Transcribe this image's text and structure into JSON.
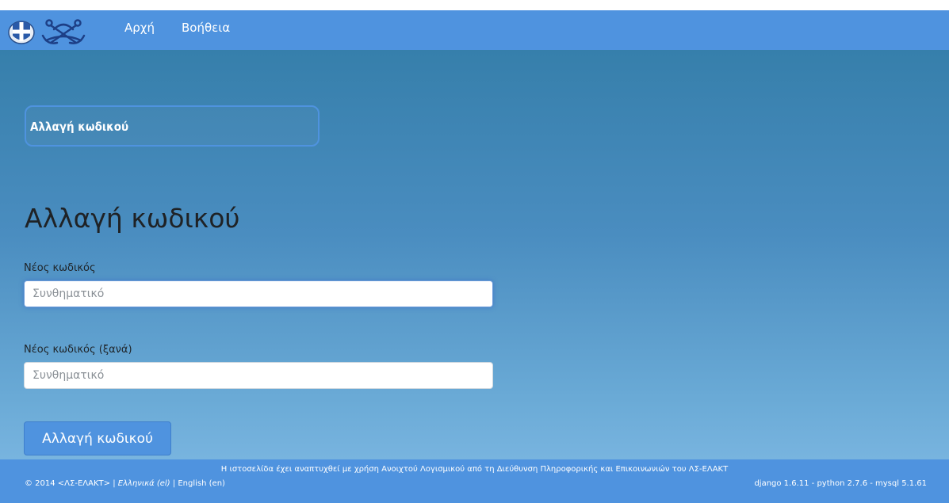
{
  "navbar": {
    "links": [
      "Αρχή",
      "Βοήθεια"
    ],
    "icons": [
      "greek-coat-of-arms-icon",
      "crossed-anchors-icon"
    ]
  },
  "breadcrumb": {
    "label": "Αλλαγή κωδικού"
  },
  "page": {
    "title": "Αλλαγή κωδικού"
  },
  "form": {
    "new_password": {
      "label": "Νέος κωδικός",
      "placeholder": "Συνθηματικό",
      "value": ""
    },
    "repeat_password": {
      "label": "Νέος κωδικός (ξανά)",
      "placeholder": "Συνθηματικό",
      "value": ""
    },
    "submit_label": "Αλλαγή κωδικού"
  },
  "footer": {
    "developed_by": "Η ιστοσελίδα έχει αναπτυχθεί με χρήση Ανοιχτού Λογισμικού από τη Διεύθυνση Πληροφορικής και Επικοινωνιών του ΛΣ-ΕΛΑΚΤ",
    "copyright": "© 2014 <ΛΣ-ΕΛΑΚΤ>",
    "separator": "|",
    "lang_greek": "Ελληνικά (el)",
    "lang_english": "English (en)",
    "versions": "django 1.6.11 - python 2.7.6 - mysql 5.1.61"
  },
  "colors": {
    "navbar": "#4f93df",
    "background_top": "#367fab",
    "background_bottom": "#78b4df",
    "button": "#4f93df"
  }
}
